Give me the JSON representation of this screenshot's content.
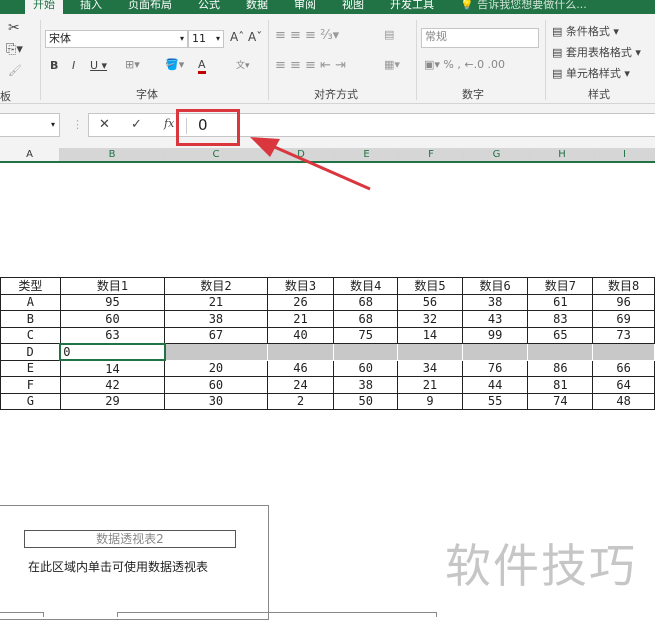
{
  "tabs": [
    "开始",
    "插入",
    "页面布局",
    "公式",
    "数据",
    "审阅",
    "视图",
    "开发工具"
  ],
  "tell_me": "告诉我您想要做什么...",
  "font": {
    "name": "宋体",
    "size": "11"
  },
  "groups": {
    "clipboard": "板",
    "font": "字体",
    "alignment": "对齐方式",
    "number": "数字",
    "styles": "样式"
  },
  "number_format": "常规",
  "styles": [
    "条件格式",
    "套用表格格式",
    "单元格样式"
  ],
  "formula": {
    "value": "0",
    "fx": "fx",
    "cancel": "✕",
    "enter": "✓"
  },
  "columns": [
    "A",
    "B",
    "C",
    "D",
    "E",
    "F",
    "G",
    "H",
    "I"
  ],
  "table": {
    "headers": [
      "类型",
      "数目1",
      "数目2",
      "数目3",
      "数目4",
      "数目5",
      "数目6",
      "数目7",
      "数目8"
    ],
    "rows": [
      [
        "A",
        "95",
        "21",
        "26",
        "68",
        "56",
        "38",
        "61",
        "96"
      ],
      [
        "B",
        "60",
        "38",
        "21",
        "68",
        "32",
        "43",
        "83",
        "69"
      ],
      [
        "C",
        "63",
        "67",
        "40",
        "75",
        "14",
        "99",
        "65",
        "73"
      ],
      [
        "D",
        "0",
        "",
        "",
        "",
        "",
        "",
        "",
        ""
      ],
      [
        "E",
        "14",
        "20",
        "46",
        "60",
        "34",
        "76",
        "86",
        "66"
      ],
      [
        "F",
        "42",
        "60",
        "24",
        "38",
        "21",
        "44",
        "81",
        "64"
      ],
      [
        "G",
        "29",
        "30",
        "2",
        "50",
        "9",
        "55",
        "74",
        "48"
      ]
    ]
  },
  "pivot": {
    "name": "数据透视表2",
    "hint": "在此区域内单击可使用数据透视表"
  },
  "watermark": "软件技巧",
  "colors": {
    "accent": "#217346",
    "highlight": "#d9363e"
  }
}
